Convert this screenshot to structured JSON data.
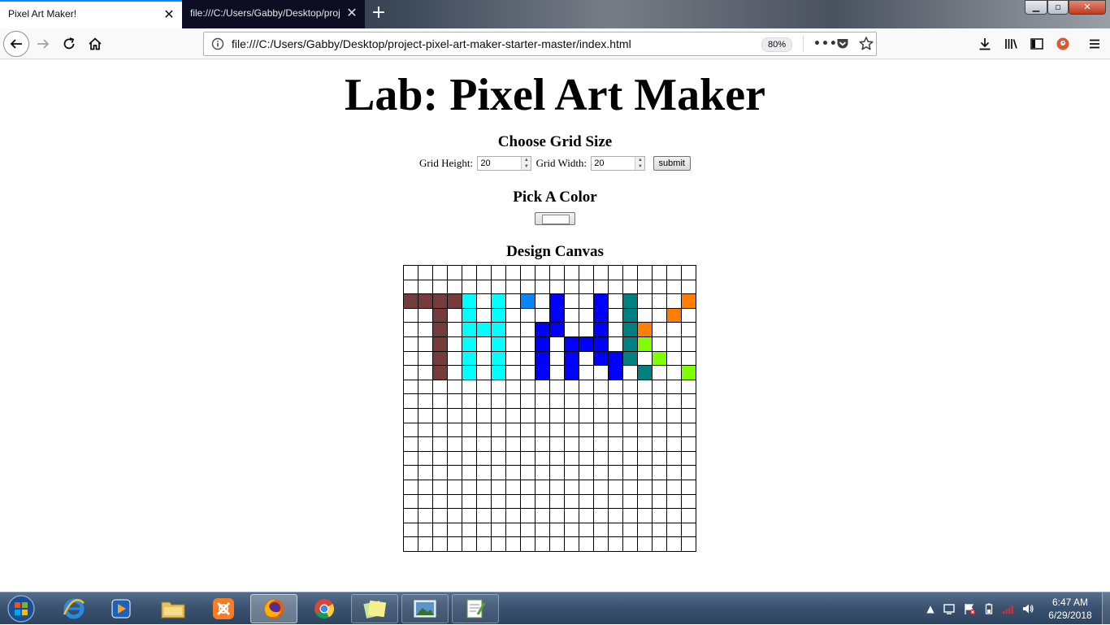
{
  "browser": {
    "tabs": [
      {
        "title": "Pixel Art Maker!",
        "active": true
      },
      {
        "title": "file:///C:/Users/Gabby/Desktop/proj",
        "active": false
      }
    ],
    "new_tab_glyph": "+",
    "close_glyph": "✕",
    "window_controls": {
      "minimize": "▁",
      "maximize": "▫",
      "close": "✕"
    },
    "url": "file:///C:/Users/Gabby/Desktop/project-pixel-art-maker-starter-master/index.html",
    "zoom": "80%",
    "page_actions": "•••",
    "accent_color": "#0a84ff"
  },
  "page": {
    "title": "Lab: Pixel Art Maker",
    "grid_section": {
      "heading": "Choose Grid Size",
      "height_label": "Grid Height:",
      "height_value": "20",
      "width_label": "Grid Width:",
      "width_value": "20",
      "submit_label": "submit"
    },
    "color_section": {
      "heading": "Pick A Color",
      "selected_color": "#ffffff"
    },
    "canvas_section": {
      "heading": "Design Canvas",
      "rows": 20,
      "cols": 20,
      "colors": {
        "B": "#763c3c",
        "C": "#00ffff",
        "L": "#0a84ff",
        "U": "#0000ff",
        "T": "#008080",
        "O": "#ff8000",
        "G": "#80ff00"
      },
      "grid": [
        "....................",
        "....................",
        "BBBBC.C.L.U..U.T...O",
        "..B.C.C...U..U.T..O.",
        "..B.CCC..UU..U.TO...",
        "..B.C.C..U.UUU.TG...",
        "..B.C.C..U.U.UUT.G..",
        "..B.C.C..U.U..U.T..G",
        "....................",
        "....................",
        "....................",
        "....................",
        "....................",
        "....................",
        "....................",
        "....................",
        "....................",
        "....................",
        "....................",
        "...................."
      ]
    }
  },
  "taskbar": {
    "apps": [
      "internet-explorer",
      "media-player",
      "file-explorer",
      "xampp",
      "firefox",
      "chrome",
      "sticky-notes",
      "photo-viewer",
      "notepad"
    ],
    "clock_time": "6:47 AM",
    "clock_date": "6/29/2018",
    "tray_expand": "▲"
  }
}
